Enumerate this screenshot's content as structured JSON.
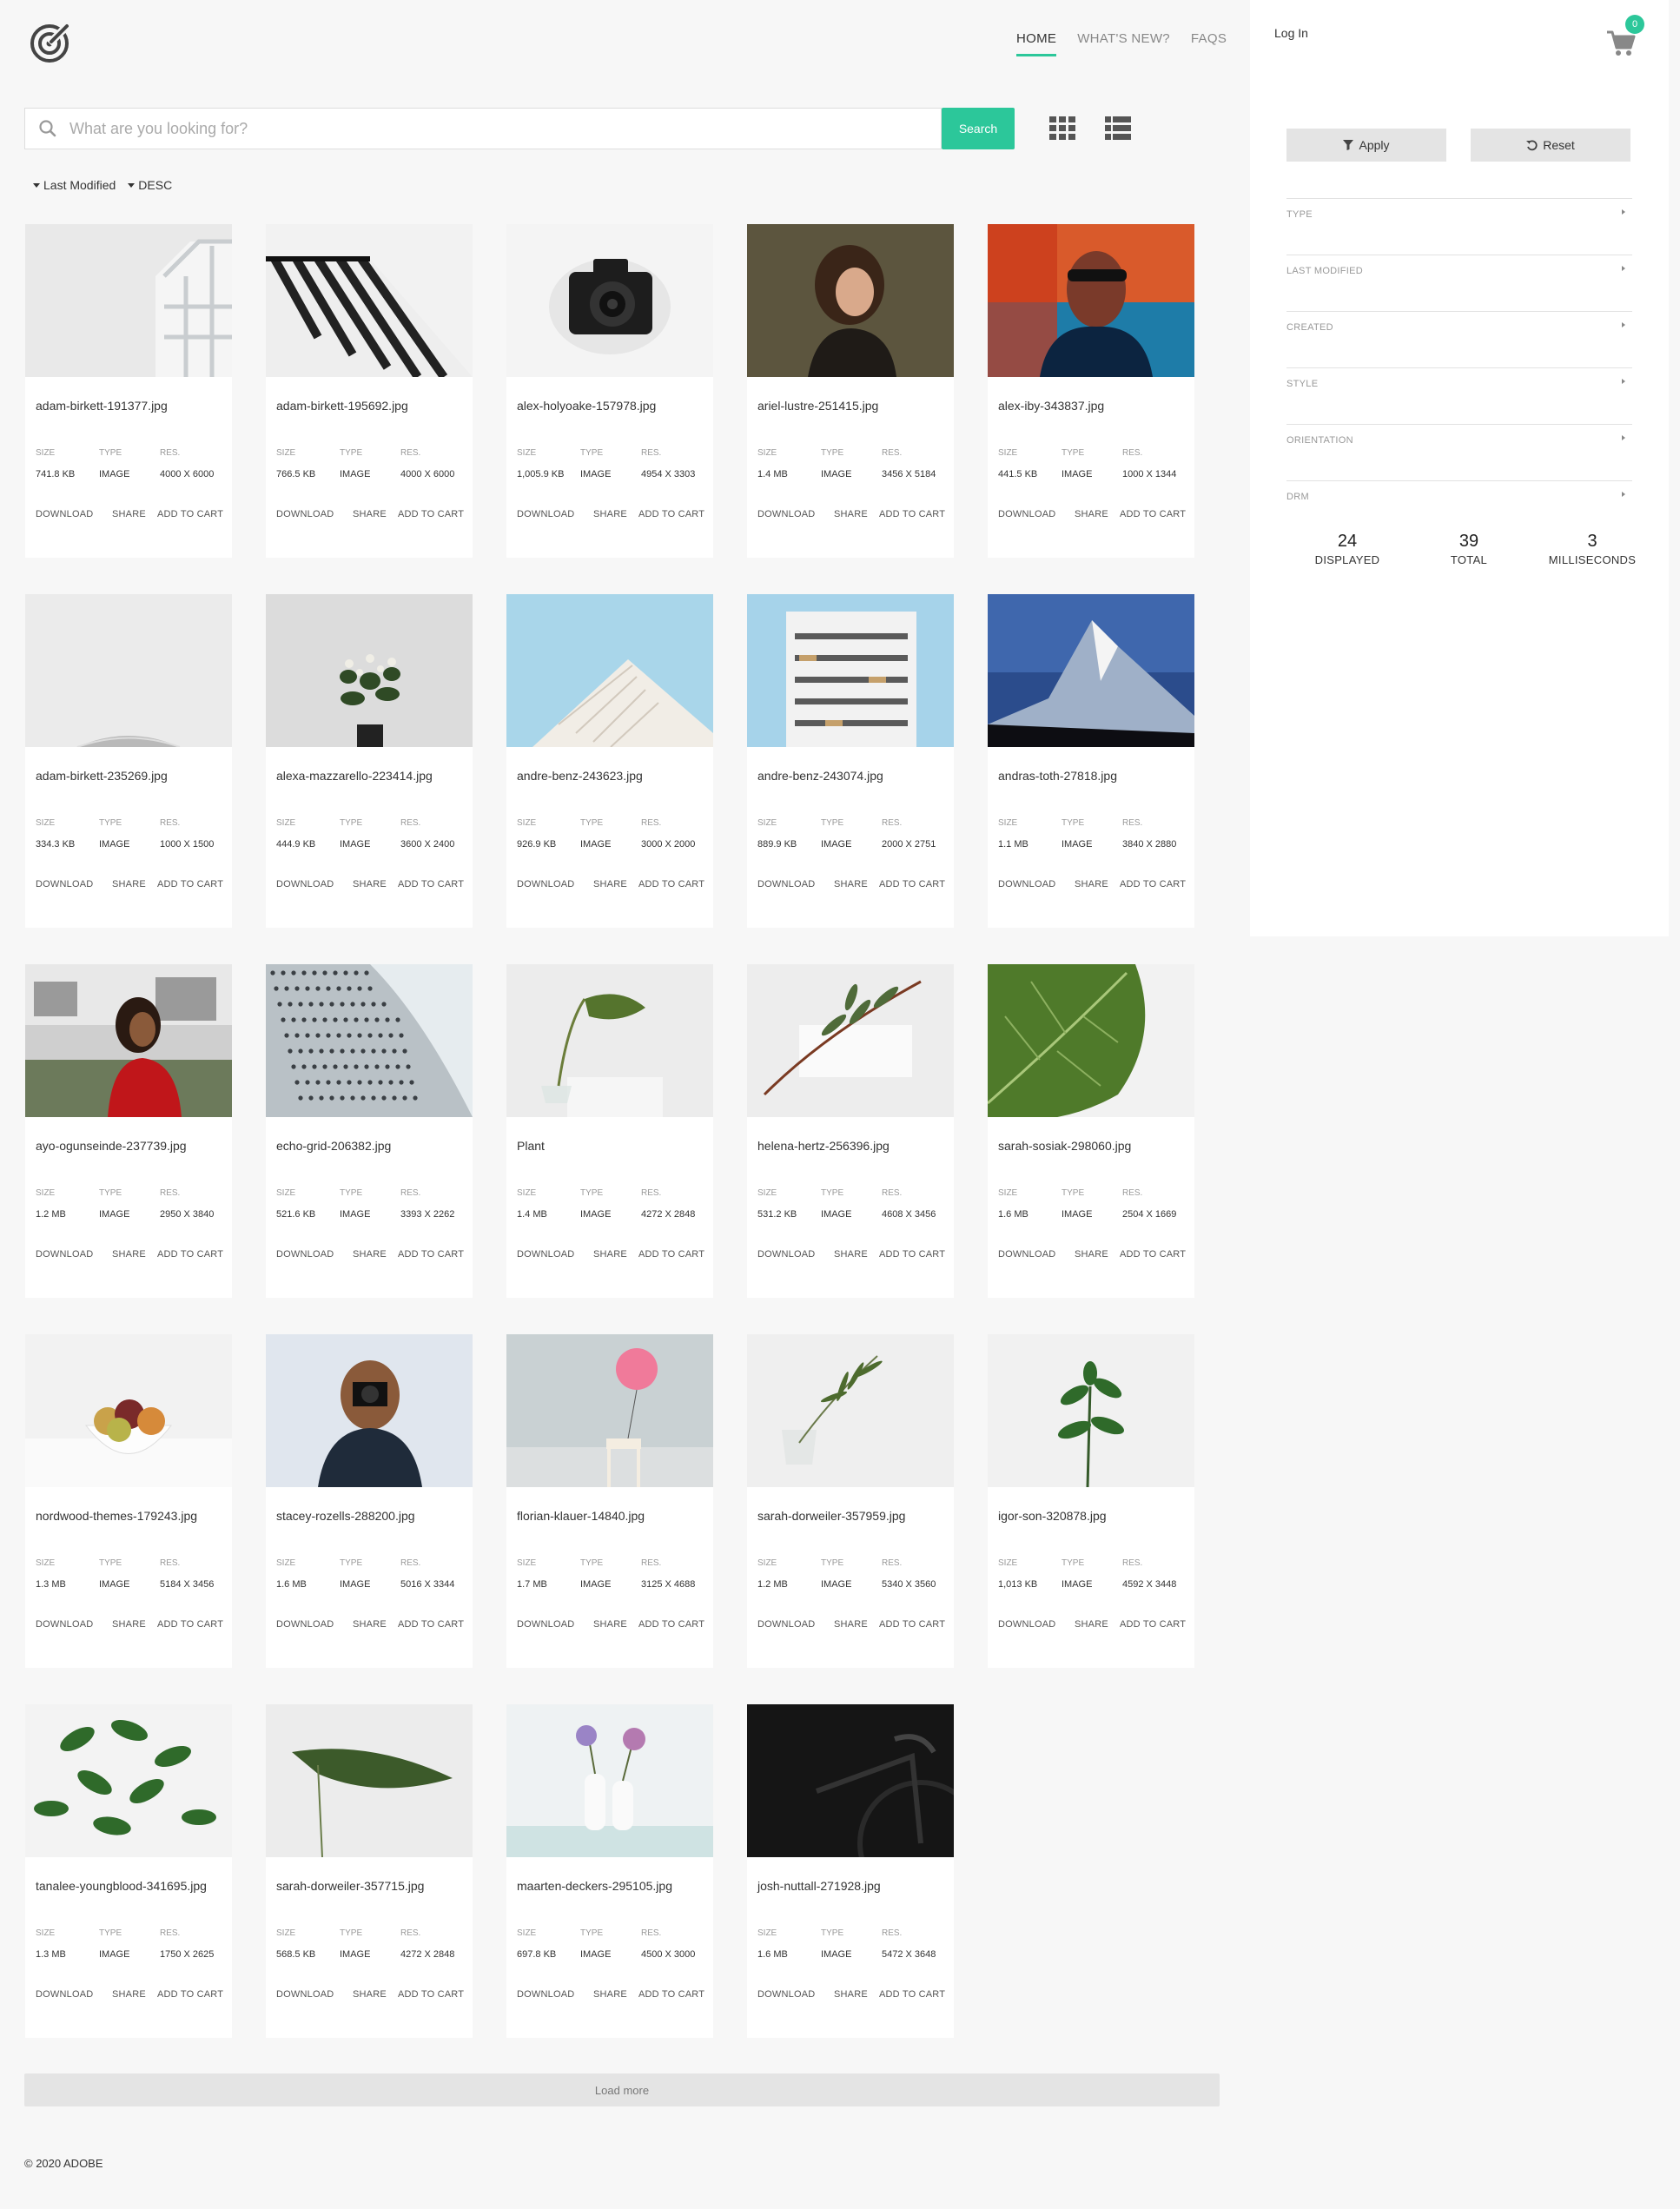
{
  "nav": {
    "items": [
      {
        "label": "HOME",
        "active": true
      },
      {
        "label": "WHAT'S NEW?",
        "active": false
      },
      {
        "label": "FAQS",
        "active": false
      }
    ]
  },
  "search": {
    "placeholder": "What are you looking for?",
    "value": "",
    "button_label": "Search"
  },
  "sort": {
    "field": "Last Modified",
    "direction": "DESC"
  },
  "card_labels": {
    "size": "SIZE",
    "type": "TYPE",
    "res": "RES.",
    "download": "DOWNLOAD",
    "share": "SHARE",
    "add_to_cart": "ADD TO CART"
  },
  "assets": [
    {
      "name": "adam-birkett-191377.jpg",
      "size": "741.8 KB",
      "type": "IMAGE",
      "res": "4000 X 6000",
      "thumb": "building-white"
    },
    {
      "name": "adam-birkett-195692.jpg",
      "size": "766.5 KB",
      "type": "IMAGE",
      "res": "4000 X 6000",
      "thumb": "striped-awning"
    },
    {
      "name": "alex-holyoake-157978.jpg",
      "size": "1,005.9 KB",
      "type": "IMAGE",
      "res": "4954 X 3303",
      "thumb": "camera"
    },
    {
      "name": "ariel-lustre-251415.jpg",
      "size": "1.4 MB",
      "type": "IMAGE",
      "res": "3456 X 5184",
      "thumb": "portrait-woman"
    },
    {
      "name": "alex-iby-343837.jpg",
      "size": "441.5 KB",
      "type": "IMAGE",
      "res": "1000 X 1344",
      "thumb": "neon-portrait"
    },
    {
      "name": "adam-birkett-235269.jpg",
      "size": "334.3 KB",
      "type": "IMAGE",
      "res": "1000 X 1500",
      "thumb": "grey-dome"
    },
    {
      "name": "alexa-mazzarello-223414.jpg",
      "size": "444.9 KB",
      "type": "IMAGE",
      "res": "3600 X 2400",
      "thumb": "potted-flowers"
    },
    {
      "name": "andre-benz-243623.jpg",
      "size": "926.9 KB",
      "type": "IMAGE",
      "res": "3000 X 2000",
      "thumb": "building-sky"
    },
    {
      "name": "andre-benz-243074.jpg",
      "size": "889.9 KB",
      "type": "IMAGE",
      "res": "2000 X 2751",
      "thumb": "tower-block"
    },
    {
      "name": "andras-toth-27818.jpg",
      "size": "1.1 MB",
      "type": "IMAGE",
      "res": "3840 X 2880",
      "thumb": "mountain"
    },
    {
      "name": "ayo-ogunseinde-237739.jpg",
      "size": "1.2 MB",
      "type": "IMAGE",
      "res": "2950 X 3840",
      "thumb": "woman-red"
    },
    {
      "name": "echo-grid-206382.jpg",
      "size": "521.6 KB",
      "type": "IMAGE",
      "res": "3393 X 2262",
      "thumb": "perforated-building"
    },
    {
      "name": "Plant",
      "size": "1.4 MB",
      "type": "IMAGE",
      "res": "4272 X 2848",
      "thumb": "monstera-vase"
    },
    {
      "name": "helena-hertz-256396.jpg",
      "size": "531.2 KB",
      "type": "IMAGE",
      "res": "4608 X 3456",
      "thumb": "olive-branch"
    },
    {
      "name": "sarah-sosiak-298060.jpg",
      "size": "1.6 MB",
      "type": "IMAGE",
      "res": "2504 X 1669",
      "thumb": "fig-leaf"
    },
    {
      "name": "nordwood-themes-179243.jpg",
      "size": "1.3 MB",
      "type": "IMAGE",
      "res": "5184 X 3456",
      "thumb": "fruit-bowl"
    },
    {
      "name": "stacey-rozells-288200.jpg",
      "size": "1.6 MB",
      "type": "IMAGE",
      "res": "5016 X 3344",
      "thumb": "photographer"
    },
    {
      "name": "florian-klauer-14840.jpg",
      "size": "1.7 MB",
      "type": "IMAGE",
      "res": "3125 X 4688",
      "thumb": "pink-balloon"
    },
    {
      "name": "sarah-dorweiler-357959.jpg",
      "size": "1.2 MB",
      "type": "IMAGE",
      "res": "5340 X 3560",
      "thumb": "palm-glass"
    },
    {
      "name": "igor-son-320878.jpg",
      "size": "1,013 KB",
      "type": "IMAGE",
      "res": "4592 X 3448",
      "thumb": "green-sprout"
    },
    {
      "name": "tanalee-youngblood-341695.jpg",
      "size": "1.3 MB",
      "type": "IMAGE",
      "res": "1750 X 2625",
      "thumb": "leafy-plant"
    },
    {
      "name": "sarah-dorweiler-357715.jpg",
      "size": "568.5 KB",
      "type": "IMAGE",
      "res": "4272 X 2848",
      "thumb": "single-leaf"
    },
    {
      "name": "maarten-deckers-295105.jpg",
      "size": "697.8 KB",
      "type": "IMAGE",
      "res": "4500 X 3000",
      "thumb": "vases-flowers"
    },
    {
      "name": "josh-nuttall-271928.jpg",
      "size": "1.6 MB",
      "type": "IMAGE",
      "res": "5472 X 3648",
      "thumb": "bicycle-dark"
    }
  ],
  "load_more_label": "Load more",
  "footer": "© 2020 ADOBE",
  "panel": {
    "login_label": "Log In",
    "cart_count": "0",
    "apply_label": "Apply",
    "reset_label": "Reset",
    "facets": [
      "TYPE",
      "LAST MODIFIED",
      "CREATED",
      "STYLE",
      "ORIENTATION",
      "DRM"
    ],
    "stats": [
      {
        "value": "24",
        "label": "DISPLAYED"
      },
      {
        "value": "39",
        "label": "TOTAL"
      },
      {
        "value": "3",
        "label": "MILLISECONDS"
      }
    ]
  },
  "colors": {
    "accent": "#2cc79a",
    "background": "#f7f7f7",
    "panel": "#ffffff"
  }
}
